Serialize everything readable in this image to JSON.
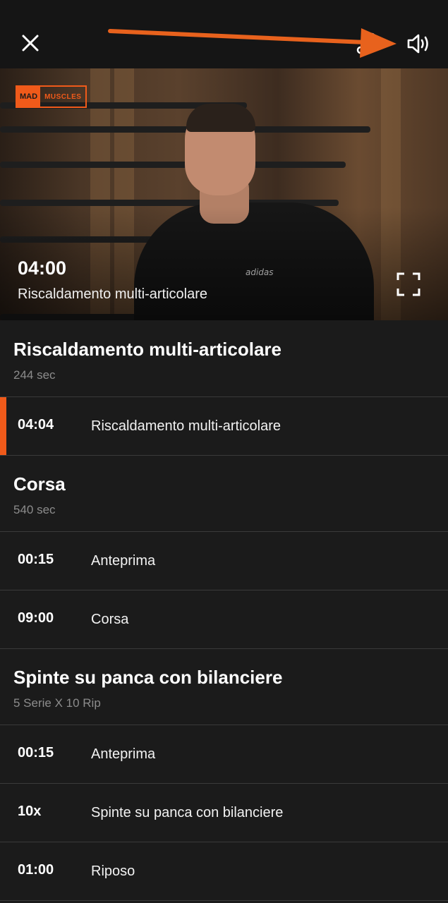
{
  "topbar": {
    "close_icon": "close-icon",
    "share_icon": "share-icon",
    "sound_icon": "speaker-icon",
    "annotation_arrow_color": "#e8621d"
  },
  "video": {
    "brand_left": "MAD",
    "brand_right": "MUSCLES",
    "shirt_brand": "adidas",
    "time": "04:00",
    "title": "Riscaldamento multi-articolare",
    "fullscreen_icon": "fullscreen-icon"
  },
  "sections": [
    {
      "title": "Riscaldamento multi-articolare",
      "subtitle": "244 sec",
      "items": [
        {
          "time": "04:04",
          "name": "Riscaldamento multi-articolare",
          "active": true
        }
      ]
    },
    {
      "title": "Corsa",
      "subtitle": "540 sec",
      "items": [
        {
          "time": "00:15",
          "name": "Anteprima"
        },
        {
          "time": "09:00",
          "name": "Corsa"
        }
      ]
    },
    {
      "title": "Spinte su panca con bilanciere",
      "subtitle": "5 Serie X 10 Rip",
      "items": [
        {
          "time": "00:15",
          "name": "Anteprima"
        },
        {
          "time": "10x",
          "name": "Spinte su panca con bilanciere"
        },
        {
          "time": "01:00",
          "name": "Riposo"
        }
      ]
    }
  ],
  "colors": {
    "accent": "#f05a1a",
    "background": "#1b1b1b",
    "divider": "#3a3a3a",
    "subtitle": "#8c8c8c"
  }
}
